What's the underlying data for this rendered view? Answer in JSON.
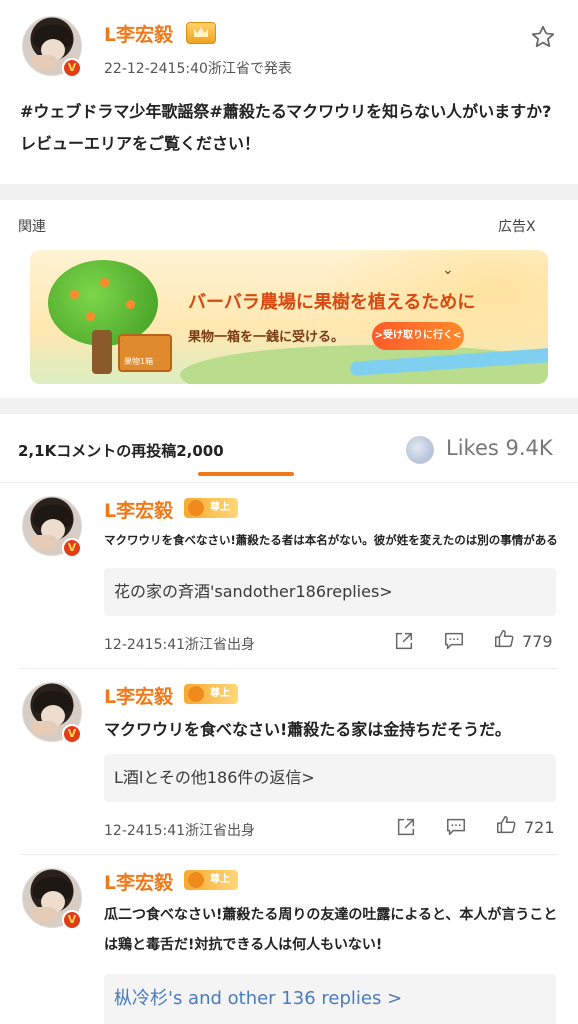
{
  "post": {
    "username": "L李宏毅",
    "meta": "22-12-2415:40浙江省で発表",
    "text": "#ウェブドラマ少年歌謡祭#蕭殺たるマクワウリを知らない人がいますか?レビューエリアをご覧ください！"
  },
  "ad": {
    "related_label": "関連",
    "ad_close": "広告X",
    "banner_title": "バーバラ農場に果樹を植えるために",
    "banner_subtitle": "果物一箱を一銭に受ける。",
    "banner_button": ">受け取りに行く<",
    "box_label": "果物1箱"
  },
  "stats": {
    "left": "2,1Kコメントの再投稿2,000",
    "likes": "Likes 9.4K"
  },
  "comments": [
    {
      "username": "L李宏毅",
      "badge": "尊上",
      "text": "マクワウリを食べなさい!蕭殺たる者は本名がない。彼が姓を変えたのは別の事情がある",
      "reply": "花の家の斉酒'sandother186replies>",
      "meta": "12-2415:41浙江省出身",
      "likes": "779"
    },
    {
      "username": "L李宏毅",
      "badge": "尊上",
      "text": "マクワウリを食べなさい!蕭殺たる家は金持ちだそうだ。",
      "reply": "L酒lとその他186件の返信>",
      "meta": "12-2415:41浙江省出身",
      "likes": "721"
    },
    {
      "username": "L李宏毅",
      "badge": "尊上",
      "text": "瓜二つ食べなさい!蕭殺たる周りの友達の吐露によると、本人が言うことは鶏と毒舌だ!対抗できる人は何人もいない!",
      "reply_name": "枞冷杉",
      "reply_rest": "'s and other 136 replies >"
    }
  ]
}
